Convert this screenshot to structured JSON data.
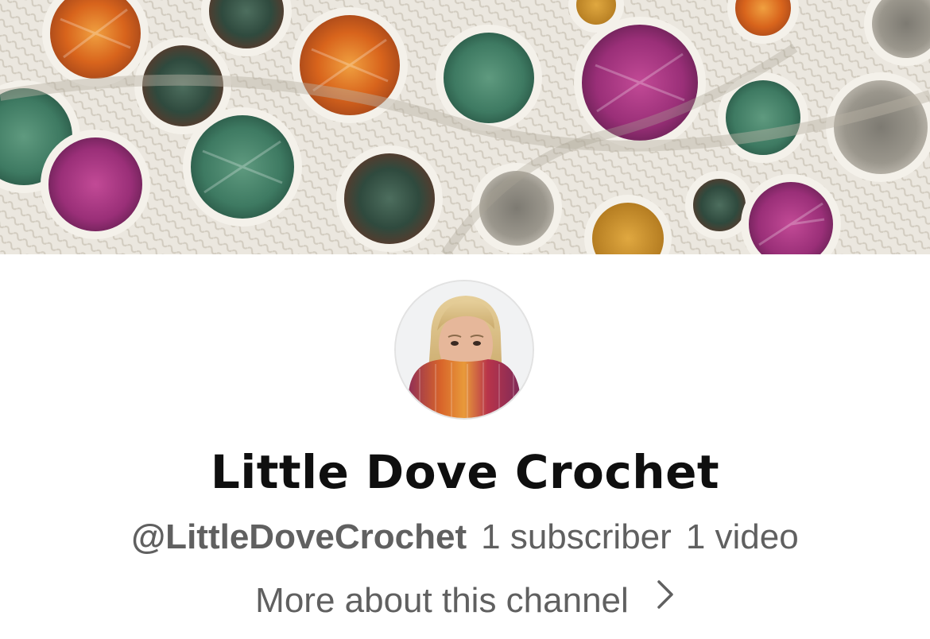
{
  "channel": {
    "name": "Little Dove Crochet",
    "handle": "@LittleDoveCrochet",
    "subscribers": "1 subscriber",
    "videos": "1 video"
  },
  "more_link": {
    "label": "More about this channel",
    "icon": "chevron-right-icon"
  },
  "banner": {
    "icon": "crochet-granny-square-banner",
    "colors": [
      "#e8e4dc",
      "#d86a1c",
      "#9e2f7a",
      "#3f7a63",
      "#2f5a4c",
      "#c78a2a",
      "#6b3a2a"
    ]
  },
  "avatar": {
    "icon": "profile-photo-avatar"
  },
  "colors": {
    "title": "#0f0f0f",
    "secondary_text": "#606060",
    "background": "#ffffff"
  }
}
